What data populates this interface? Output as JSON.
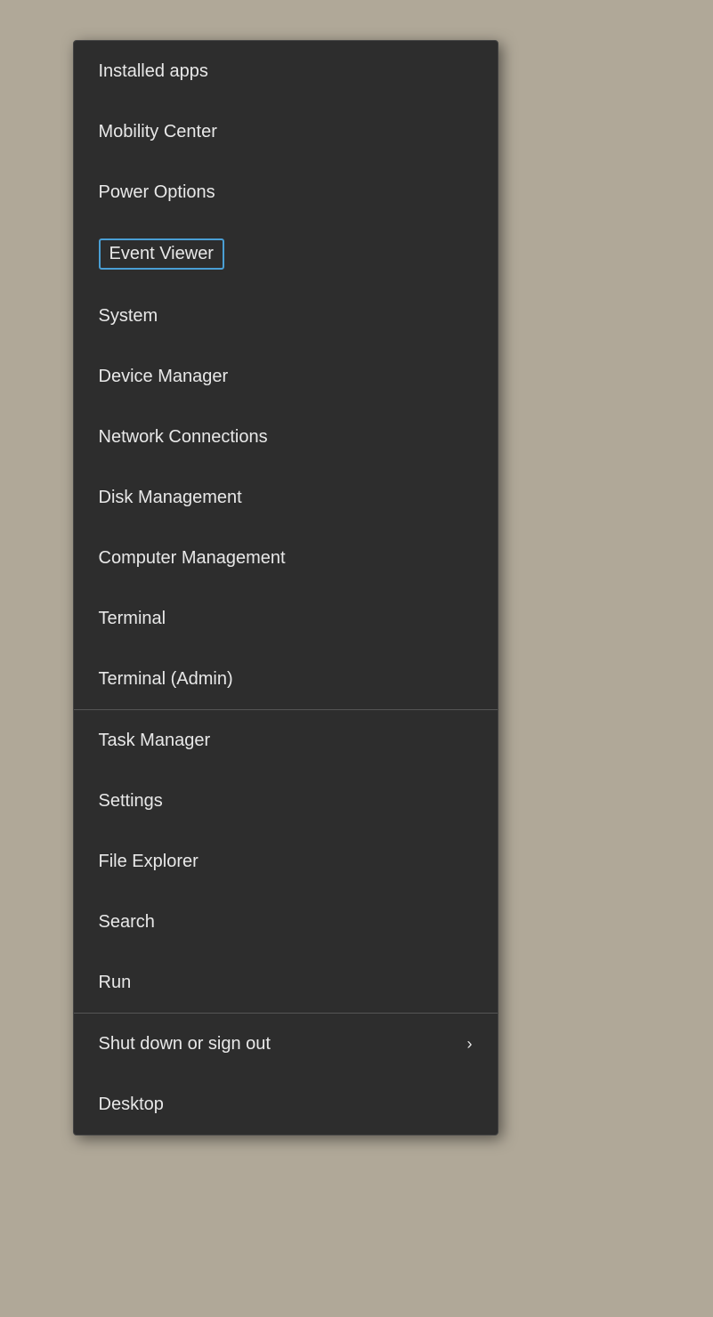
{
  "menu": {
    "items": [
      {
        "id": "installed-apps",
        "label": "Installed apps",
        "highlighted": false,
        "has_arrow": false,
        "divider_after": false
      },
      {
        "id": "mobility-center",
        "label": "Mobility Center",
        "highlighted": false,
        "has_arrow": false,
        "divider_after": false
      },
      {
        "id": "power-options",
        "label": "Power Options",
        "highlighted": false,
        "has_arrow": false,
        "divider_after": false
      },
      {
        "id": "event-viewer",
        "label": "Event Viewer",
        "highlighted": true,
        "has_arrow": false,
        "divider_after": false
      },
      {
        "id": "system",
        "label": "System",
        "highlighted": false,
        "has_arrow": false,
        "divider_after": false
      },
      {
        "id": "device-manager",
        "label": "Device Manager",
        "highlighted": false,
        "has_arrow": false,
        "divider_after": false
      },
      {
        "id": "network-connections",
        "label": "Network Connections",
        "highlighted": false,
        "has_arrow": false,
        "divider_after": false
      },
      {
        "id": "disk-management",
        "label": "Disk Management",
        "highlighted": false,
        "has_arrow": false,
        "divider_after": false
      },
      {
        "id": "computer-management",
        "label": "Computer Management",
        "highlighted": false,
        "has_arrow": false,
        "divider_after": false
      },
      {
        "id": "terminal",
        "label": "Terminal",
        "highlighted": false,
        "has_arrow": false,
        "divider_after": false
      },
      {
        "id": "terminal-admin",
        "label": "Terminal (Admin)",
        "highlighted": false,
        "has_arrow": false,
        "divider_after": true
      },
      {
        "id": "task-manager",
        "label": "Task Manager",
        "highlighted": false,
        "has_arrow": false,
        "divider_after": false
      },
      {
        "id": "settings",
        "label": "Settings",
        "highlighted": false,
        "has_arrow": false,
        "divider_after": false
      },
      {
        "id": "file-explorer",
        "label": "File Explorer",
        "highlighted": false,
        "has_arrow": false,
        "divider_after": false
      },
      {
        "id": "search",
        "label": "Search",
        "highlighted": false,
        "has_arrow": false,
        "divider_after": false
      },
      {
        "id": "run",
        "label": "Run",
        "highlighted": false,
        "has_arrow": false,
        "divider_after": true
      },
      {
        "id": "shut-down-sign-out",
        "label": "Shut down or sign out",
        "highlighted": false,
        "has_arrow": true,
        "divider_after": false
      },
      {
        "id": "desktop",
        "label": "Desktop",
        "highlighted": false,
        "has_arrow": false,
        "divider_after": false
      }
    ]
  }
}
